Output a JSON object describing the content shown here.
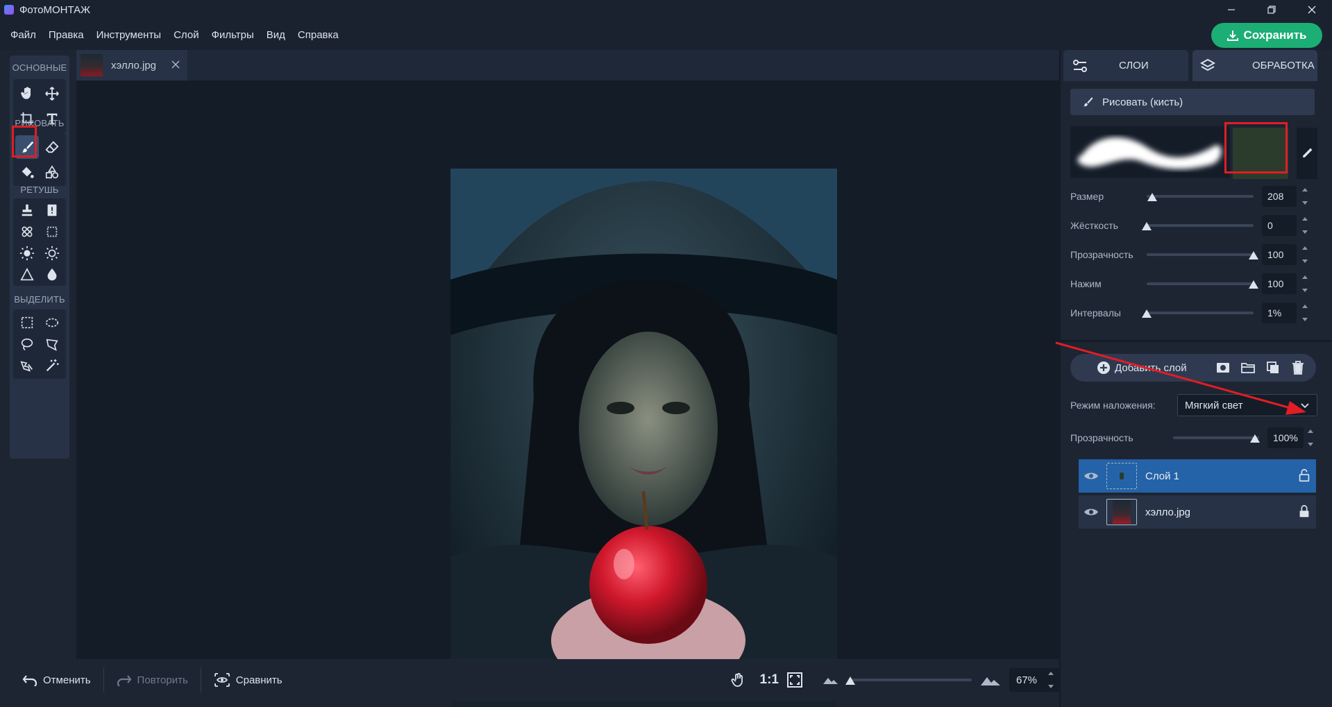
{
  "app": {
    "title": "ФотоМОНТАЖ"
  },
  "menu": [
    "Файл",
    "Правка",
    "Инструменты",
    "Слой",
    "Фильтры",
    "Вид",
    "Справка"
  ],
  "save": {
    "label": "Сохранить"
  },
  "toolbar": {
    "sections": [
      "ОСНОВНЫЕ",
      "РИСОВАТЬ",
      "РЕТУШЬ",
      "ВЫДЕЛИТЬ"
    ],
    "active_tool": "brush-tool"
  },
  "file_tab": {
    "name": "хэлло.jpg"
  },
  "bottom": {
    "undo": "Отменить",
    "redo": "Повторить",
    "compare": "Сравнить",
    "actual_size": "1:1",
    "zoom": "67%",
    "zoom_level": 0.67
  },
  "right_panel": {
    "tabs": [
      "СЛОИ",
      "ОБРАБОТКА"
    ],
    "draw_button": "Рисовать (кисть)",
    "brush_color": "#2c3c2c",
    "params": [
      {
        "label": "Размер",
        "value": "208",
        "level": 0.05
      },
      {
        "label": "Жёсткость",
        "value": "0",
        "level": 0.0
      },
      {
        "label": "Прозрачность",
        "value": "100",
        "level": 1.0
      },
      {
        "label": "Нажим",
        "value": "100",
        "level": 1.0
      },
      {
        "label": "Интервалы",
        "value": "1%",
        "level": 0.0
      }
    ],
    "add_layer": "Добавить слой",
    "blend_label": "Режим наложения:",
    "blend_value": "Мягкий свет",
    "opacity_label": "Прозрачность",
    "opacity_value": "100%",
    "layers": [
      {
        "name": "Слой 1",
        "selected": true,
        "locked": false
      },
      {
        "name": "хэлло.jpg",
        "selected": false,
        "locked": true
      }
    ]
  },
  "colors": {
    "accent": "#1cae74",
    "selected_layer": "#2463a8",
    "annotation": "#e21d24"
  }
}
